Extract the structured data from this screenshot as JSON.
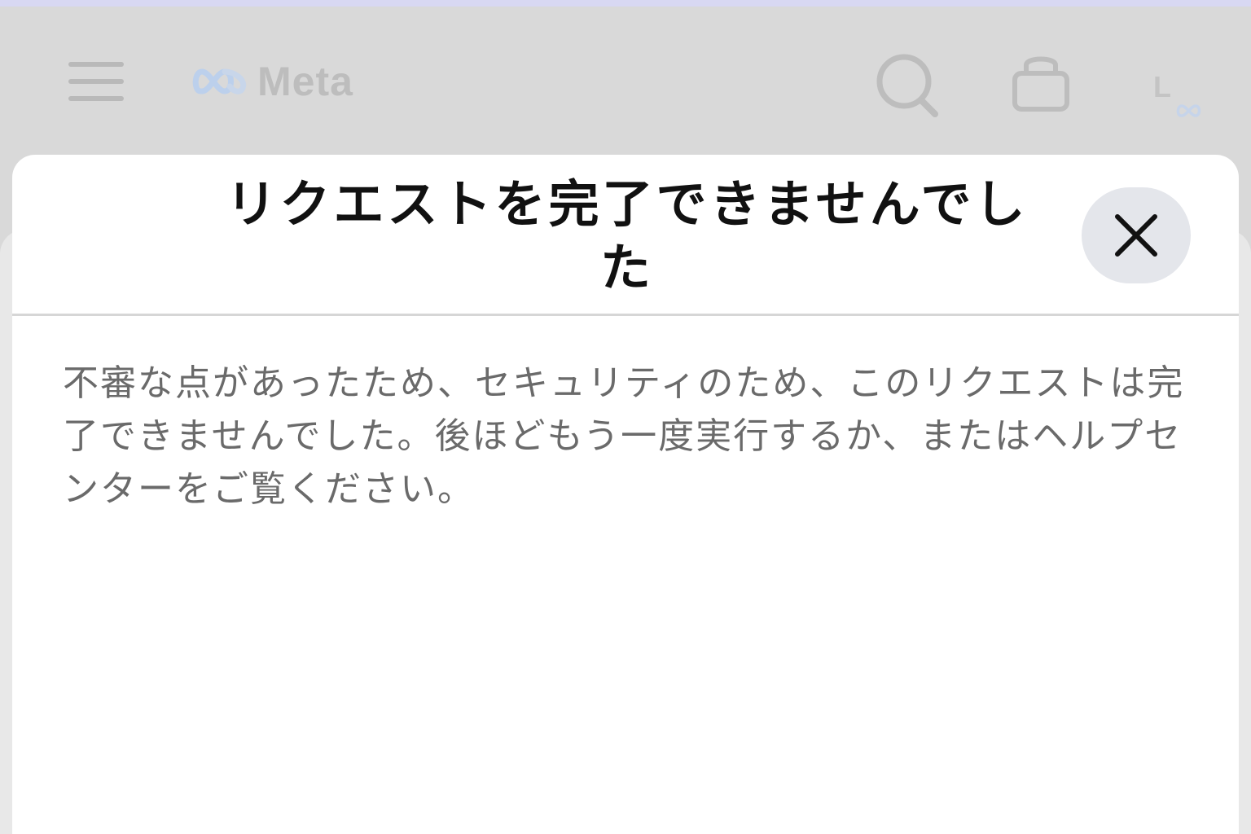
{
  "header": {
    "logo_text": "Meta",
    "profile_initial": "L",
    "icons": {
      "menu": "hamburger-menu-icon",
      "search": "search-icon",
      "bag": "shopping-bag-icon",
      "profile_badge": "meta-infinity-icon"
    }
  },
  "dialog": {
    "title": "リクエストを完了できませんでした",
    "message": "不審な点があったため、セキュリティのため、このリクエストは完了できませんでした。後ほどもう一度実行するか、またはヘルプセンターをご覧ください。",
    "close_icon": "close-icon"
  },
  "colors": {
    "overlay_bg": "#d9d9d9",
    "top_strip": "#d8d8f2",
    "modal_bg": "#ffffff",
    "title_text": "#111111",
    "body_text": "#6a6a6a",
    "close_button_bg": "#e4e6eb",
    "meta_blue": "#bcd0ec"
  }
}
